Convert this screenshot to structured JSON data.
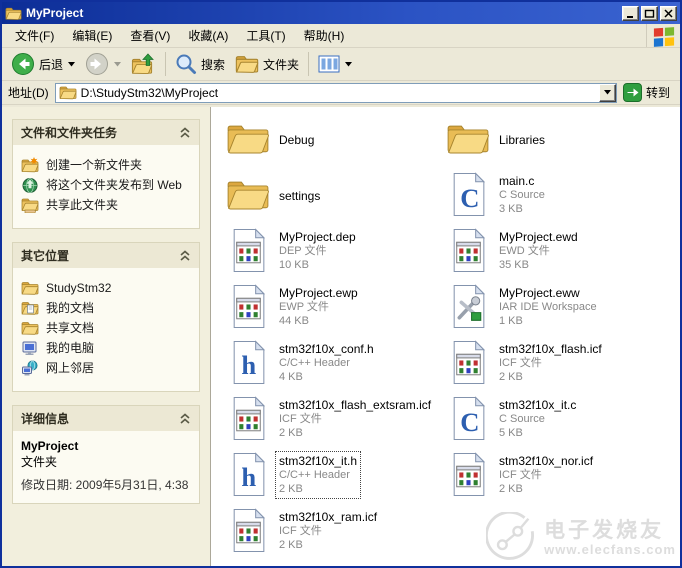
{
  "window": {
    "title": "MyProject"
  },
  "menu": {
    "items": [
      "文件(F)",
      "编辑(E)",
      "查看(V)",
      "收藏(A)",
      "工具(T)",
      "帮助(H)"
    ]
  },
  "toolbar": {
    "back_label": "后退",
    "search_label": "搜索",
    "folders_label": "文件夹"
  },
  "address": {
    "label": "地址(D)",
    "value": "D:\\StudyStm32\\MyProject",
    "go_label": "转到"
  },
  "sidebar": {
    "tasks": {
      "title": "文件和文件夹任务",
      "items": [
        "创建一个新文件夹",
        "将这个文件夹发布到 Web",
        "共享此文件夹"
      ]
    },
    "places": {
      "title": "其它位置",
      "items": [
        "StudyStm32",
        "我的文档",
        "共享文档",
        "我的电脑",
        "网上邻居"
      ]
    },
    "details": {
      "title": "详细信息",
      "name": "MyProject",
      "type": "文件夹",
      "modified": "修改日期: 2009年5月31日, 4:38"
    }
  },
  "files": {
    "left": [
      {
        "name": "Debug",
        "type": "",
        "size": ""
      },
      {
        "name": "settings",
        "type": "",
        "size": ""
      },
      {
        "name": "MyProject.dep",
        "type": "DEP 文件",
        "size": "10 KB"
      },
      {
        "name": "MyProject.ewp",
        "type": "EWP 文件",
        "size": "44 KB"
      },
      {
        "name": "stm32f10x_conf.h",
        "type": "C/C++ Header",
        "size": "4 KB"
      },
      {
        "name": "stm32f10x_flash_extsram.icf",
        "type": "ICF 文件",
        "size": "2 KB"
      },
      {
        "name": "stm32f10x_it.h",
        "type": "C/C++ Header",
        "size": "2 KB"
      },
      {
        "name": "stm32f10x_ram.icf",
        "type": "ICF 文件",
        "size": "2 KB"
      }
    ],
    "right": [
      {
        "name": "Libraries",
        "type": "",
        "size": ""
      },
      {
        "name": "main.c",
        "type": "C Source",
        "size": "3 KB"
      },
      {
        "name": "MyProject.ewd",
        "type": "EWD 文件",
        "size": "35 KB"
      },
      {
        "name": "MyProject.eww",
        "type": "IAR IDE Workspace",
        "size": "1 KB"
      },
      {
        "name": "stm32f10x_flash.icf",
        "type": "ICF 文件",
        "size": "2 KB"
      },
      {
        "name": "stm32f10x_it.c",
        "type": "C Source",
        "size": "5 KB"
      },
      {
        "name": "stm32f10x_nor.icf",
        "type": "ICF 文件",
        "size": "2 KB"
      }
    ]
  },
  "watermark": {
    "line1": "电子发烧友",
    "line2": "www.elecfans.com"
  },
  "colors": {
    "titlebar": "#0c2d96",
    "chrome": "#ece9d8",
    "sidebar_bg": "#f2efdd",
    "panel_bg": "#fcfbf2",
    "panel_head": "#ece8d4",
    "go_green": "#2f9e3f",
    "folder_yellow": "#f8da85",
    "file_meta_gray": "#888888"
  }
}
